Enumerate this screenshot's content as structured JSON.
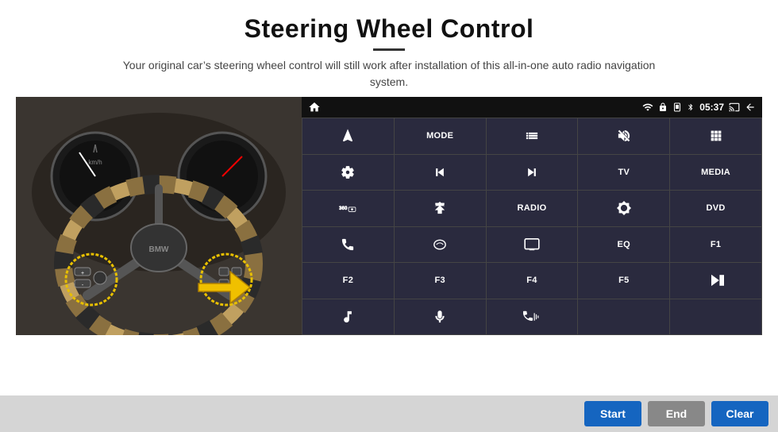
{
  "header": {
    "title": "Steering Wheel Control",
    "subtitle": "Your original car’s steering wheel control will still work after installation of this all-in-one auto radio navigation system."
  },
  "status_bar": {
    "time": "05:37",
    "icons": [
      "wifi",
      "lock",
      "sim",
      "bluetooth",
      "battery",
      "cast",
      "back"
    ]
  },
  "grid_buttons": [
    {
      "id": "r1c1",
      "type": "icon",
      "icon": "home"
    },
    {
      "id": "r1c2",
      "label": "MODE"
    },
    {
      "id": "r1c3",
      "type": "icon",
      "icon": "list"
    },
    {
      "id": "r1c4",
      "type": "icon",
      "icon": "mute"
    },
    {
      "id": "r1c5",
      "type": "icon",
      "icon": "apps"
    },
    {
      "id": "r2c1",
      "type": "icon",
      "icon": "settings"
    },
    {
      "id": "r2c2",
      "type": "icon",
      "icon": "prev"
    },
    {
      "id": "r2c3",
      "type": "icon",
      "icon": "next"
    },
    {
      "id": "r2c4",
      "label": "TV"
    },
    {
      "id": "r2c5",
      "label": "MEDIA"
    },
    {
      "id": "r3c1",
      "type": "icon",
      "icon": "360cam"
    },
    {
      "id": "r3c2",
      "type": "icon",
      "icon": "eject"
    },
    {
      "id": "r3c3",
      "label": "RADIO"
    },
    {
      "id": "r3c4",
      "type": "icon",
      "icon": "brightness"
    },
    {
      "id": "r3c5",
      "label": "DVD"
    },
    {
      "id": "r4c1",
      "type": "icon",
      "icon": "phone"
    },
    {
      "id": "r4c2",
      "type": "icon",
      "icon": "swipe"
    },
    {
      "id": "r4c3",
      "type": "icon",
      "icon": "screencast"
    },
    {
      "id": "r4c4",
      "label": "EQ"
    },
    {
      "id": "r4c5",
      "label": "F1"
    },
    {
      "id": "r5c1",
      "label": "F2"
    },
    {
      "id": "r5c2",
      "label": "F3"
    },
    {
      "id": "r5c3",
      "label": "F4"
    },
    {
      "id": "r5c4",
      "label": "F5"
    },
    {
      "id": "r5c5",
      "type": "icon",
      "icon": "playpause"
    },
    {
      "id": "r6c1",
      "type": "icon",
      "icon": "music"
    },
    {
      "id": "r6c2",
      "type": "icon",
      "icon": "mic"
    },
    {
      "id": "r6c3",
      "type": "icon",
      "icon": "volphone"
    },
    {
      "id": "r6c4",
      "label": ""
    },
    {
      "id": "r6c5",
      "label": ""
    }
  ],
  "bottom_buttons": {
    "start": "Start",
    "end": "End",
    "clear": "Clear"
  }
}
